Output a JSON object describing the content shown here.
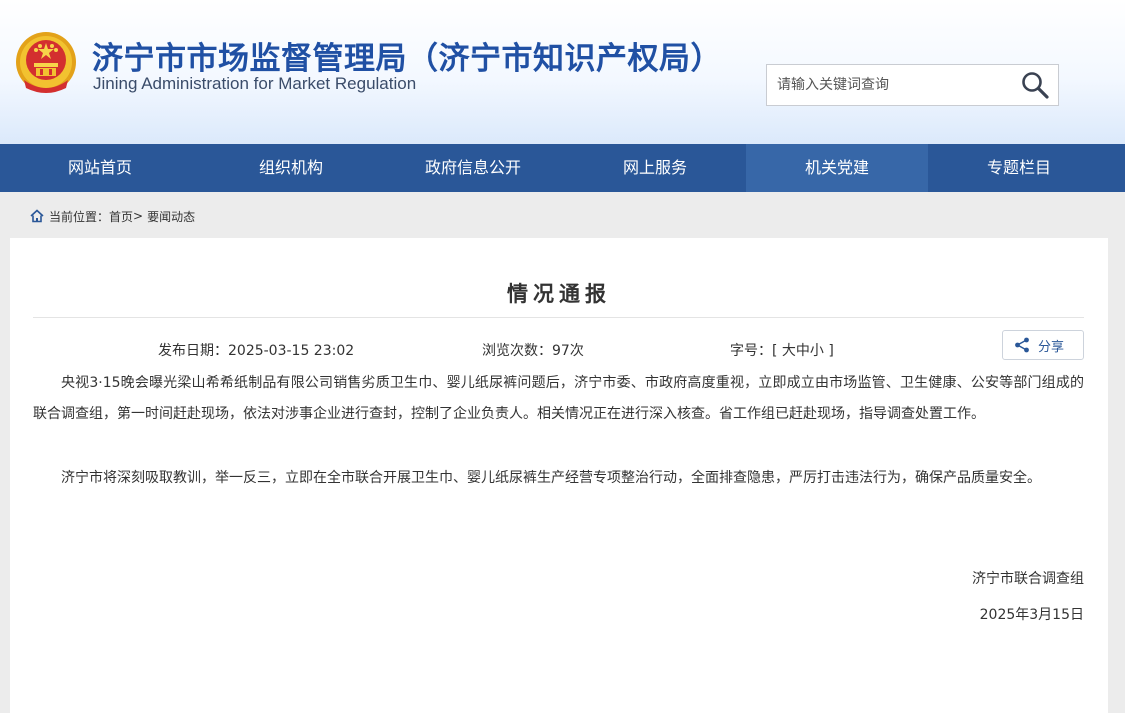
{
  "header": {
    "title": "济宁市市场监督管理局（济宁市知识产权局）",
    "subtitle": "Jining Administration for Market Regulation",
    "search_placeholder": "请输入关键词查询"
  },
  "nav": {
    "items": [
      {
        "label": "网站首页"
      },
      {
        "label": "组织机构"
      },
      {
        "label": "政府信息公开"
      },
      {
        "label": "网上服务"
      },
      {
        "label": "机关党建"
      },
      {
        "label": "专题栏目"
      }
    ],
    "active_index": 4
  },
  "breadcrumb": {
    "prefix": "当前位置：",
    "home": "首页",
    "separator": ">",
    "current": "要闻动态"
  },
  "article": {
    "title": "情况通报",
    "publish_label": "发布日期：",
    "publish_date": "2025-03-15 23:02",
    "views_label": "浏览次数：",
    "views_value": "97次",
    "font_label": "字号：",
    "font_open": "[",
    "font_large": "大",
    "font_medium": "中",
    "font_small": "小",
    "font_close": "]",
    "share_label": "分享",
    "paragraphs": [
      "央视3·15晚会曝光梁山希希纸制品有限公司销售劣质卫生巾、婴儿纸尿裤问题后，济宁市委、市政府高度重视，立即成立由市场监管、卫生健康、公安等部门组成的联合调查组，第一时间赶赴现场，依法对涉事企业进行查封，控制了企业负责人。相关情况正在进行深入核查。省工作组已赶赴现场，指导调查处置工作。",
      "济宁市将深刻吸取教训，举一反三，立即在全市联合开展卫生巾、婴儿纸尿裤生产经营专项整治行动，全面排查隐患，严厉打击违法行为，确保产品质量安全。"
    ],
    "signature": "济宁市联合调查组",
    "sign_date": "2025年3月15日"
  },
  "colors": {
    "brand_blue": "#2050a4",
    "nav_bg": "#2a5798",
    "emblem_red": "#d32f2f",
    "emblem_gold": "#f2c230"
  },
  "icons": [
    "national-emblem",
    "search-icon",
    "home-icon",
    "share-icon"
  ]
}
